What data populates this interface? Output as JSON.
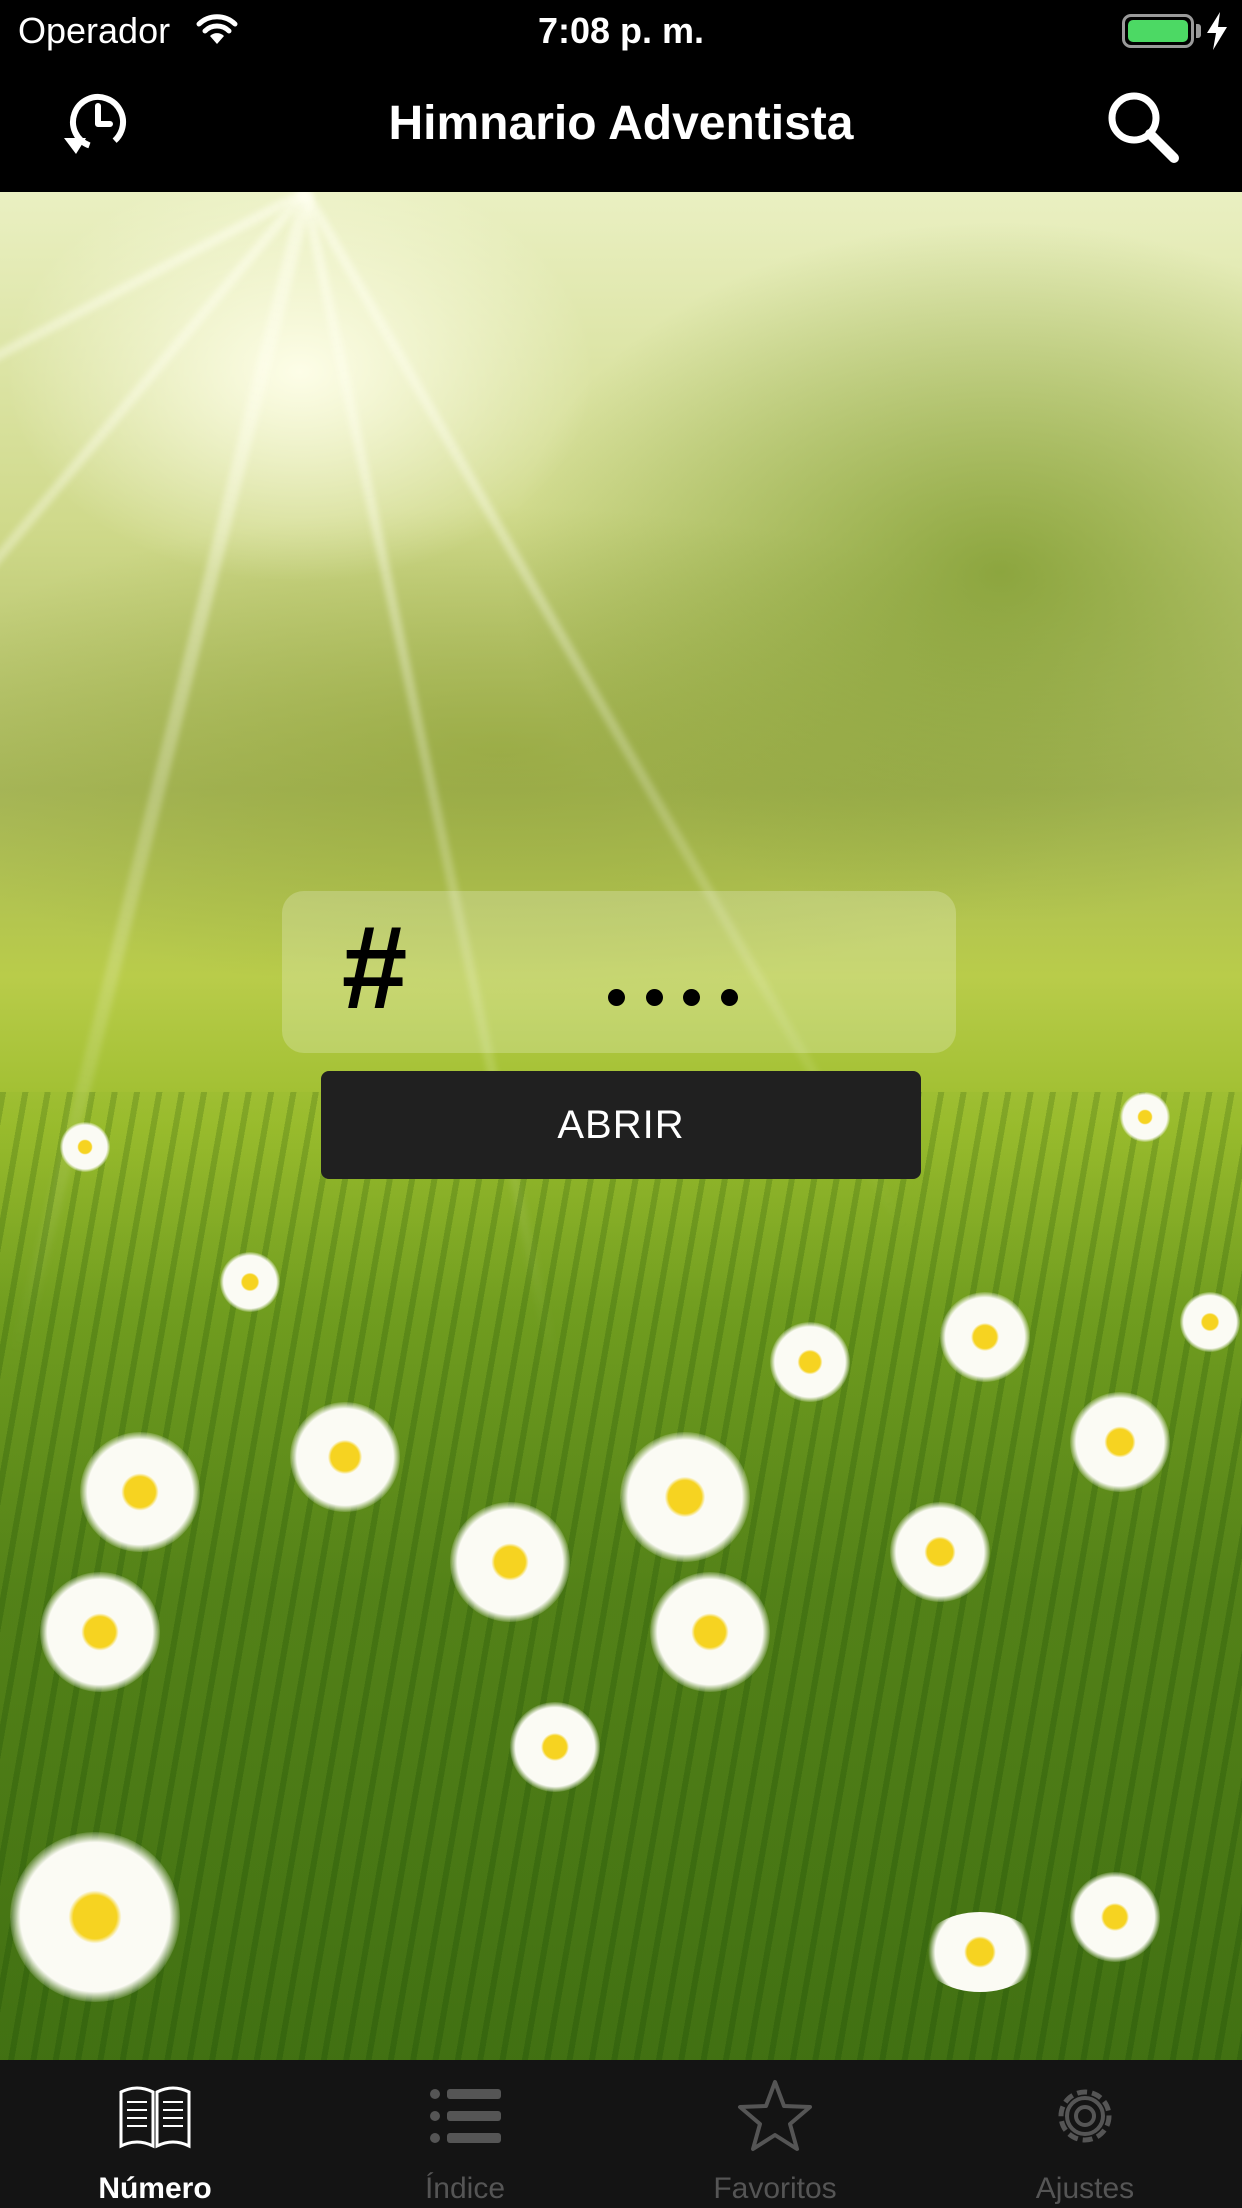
{
  "status_bar": {
    "carrier": "Operador",
    "time": "7:08 p. m."
  },
  "nav": {
    "title": "Himnario Adventista",
    "left_icon": "history-icon",
    "right_icon": "search-icon"
  },
  "entry": {
    "hash_symbol": "#",
    "open_label": "ABRIR"
  },
  "tabs": [
    {
      "label": "Número",
      "icon": "book-icon",
      "active": true
    },
    {
      "label": "Índice",
      "icon": "list-icon",
      "active": false
    },
    {
      "label": "Favoritos",
      "icon": "star-icon",
      "active": false
    },
    {
      "label": "Ajustes",
      "icon": "gear-icon",
      "active": false
    }
  ],
  "colors": {
    "bars": "#000000",
    "tab_bar": "#141414",
    "button": "#202020",
    "battery": "#4cd964",
    "tab_inactive": "#555555"
  }
}
